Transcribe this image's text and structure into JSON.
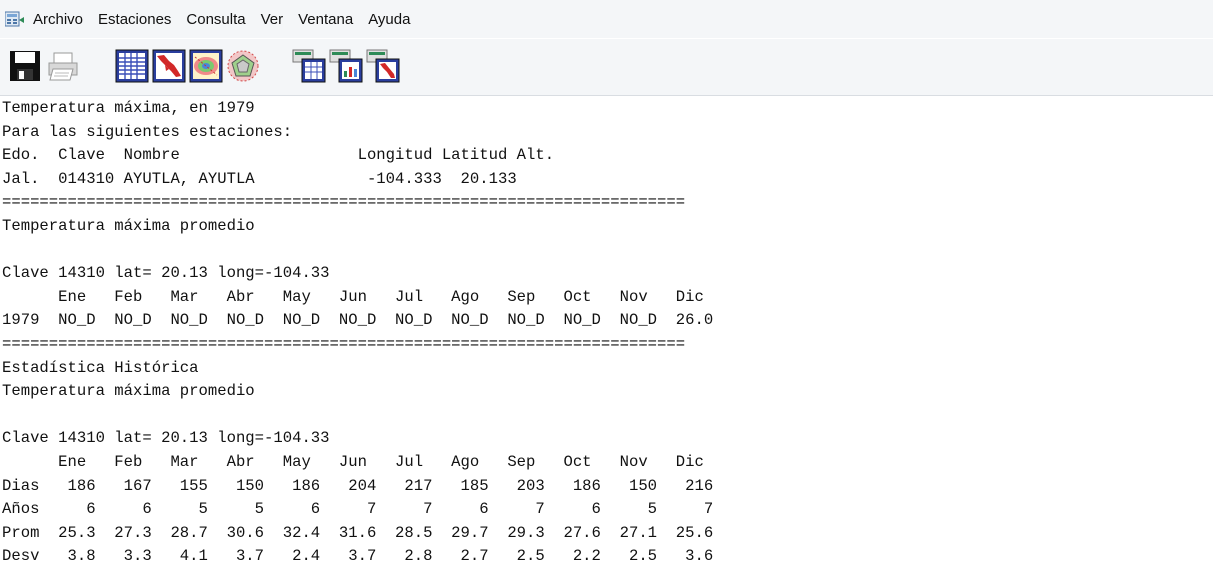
{
  "menu": [
    "Archivo",
    "Estaciones",
    "Consulta",
    "Ver",
    "Ventana",
    "Ayuda"
  ],
  "toolbar": {
    "buttons": [
      "save-icon",
      "print-icon",
      "table-grid-icon",
      "map-icon",
      "contour-map-icon",
      "polygon-map-icon",
      "station-table-icon",
      "station-chart-icon",
      "station-map-icon"
    ]
  },
  "report": {
    "title": "Temperatura máxima, en 1979",
    "stations_intro": "Para las siguientes estaciones:",
    "stations_header": "Edo.  Clave  Nombre                   Longitud Latitud Alt.",
    "station_row": "Jal.  014310 AYUTLA, AYUTLA            -104.333  20.133",
    "separator": "=========================================================================",
    "section1_title": "Temperatura máxima promedio",
    "blank": "",
    "section1_clave": "Clave 14310 lat= 20.13 long=-104.33",
    "section1_months": "      Ene   Feb   Mar   Abr   May   Jun   Jul   Ago   Sep   Oct   Nov   Dic",
    "section1_row": "1979  NO_D  NO_D  NO_D  NO_D  NO_D  NO_D  NO_D  NO_D  NO_D  NO_D  NO_D  26.0",
    "section2_title": "Estadística Histórica",
    "section2_subtitle": "Temperatura máxima promedio",
    "section2_clave": "Clave 14310 lat= 20.13 long=-104.33",
    "section2_months": "      Ene   Feb   Mar   Abr   May   Jun   Jul   Ago   Sep   Oct   Nov   Dic",
    "dias_row": "Dias   186   167   155   150   186   204   217   185   203   186   150   216",
    "anos_row": "Años     6     6     5     5     6     7     7     6     7     6     5     7",
    "prom_row": "Prom  25.3  27.3  28.7  30.6  32.4  31.6  28.5  29.7  29.3  27.6  27.1  25.6",
    "desv_row": "Desv   3.8   3.3   4.1   3.7   2.4   3.7   2.8   2.7   2.5   2.2   2.5   3.6"
  }
}
